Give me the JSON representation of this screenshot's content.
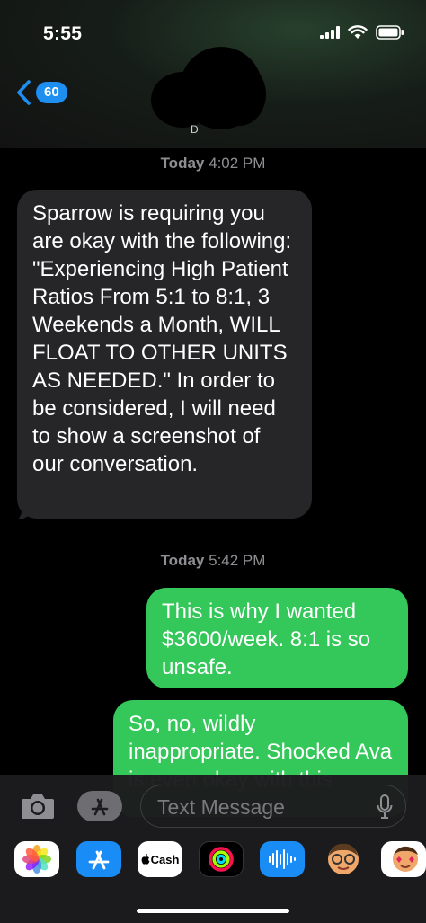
{
  "status_bar": {
    "time": "5:55"
  },
  "nav": {
    "back_count": "60",
    "contact_initial": "D"
  },
  "conversation": {
    "messages": [
      {
        "timestamp": "Today",
        "timestamp_time": "4:02 PM"
      },
      {
        "direction": "received",
        "text": "Sparrow is requiring you are okay with the following: \"Experiencing High Patient Ratios From 5:1 to 8:1, 3 Weekends a Month, WILL FLOAT TO OTHER UNITS AS NEEDED.\" In order to be considered, I will need to show a screenshot of our conversation."
      },
      {
        "timestamp": "Today",
        "timestamp_time": "5:42 PM"
      },
      {
        "direction": "sent",
        "text": "This is why I wanted $3600/week. 8:1 is so unsafe."
      },
      {
        "direction": "sent",
        "text": "So, no, wildly inappropriate. Shocked Ava is even okay with this"
      }
    ]
  },
  "composer": {
    "placeholder": "Text Message"
  },
  "app_tray": {
    "items": [
      "photos",
      "app-store",
      "cash",
      "activity",
      "audio-message",
      "memoji",
      "memoji-stickers"
    ],
    "cash_label": "Cash"
  },
  "colors": {
    "sent_bubble": "#34c759",
    "received_bubble": "#262628",
    "accent": "#1f8ef1"
  }
}
